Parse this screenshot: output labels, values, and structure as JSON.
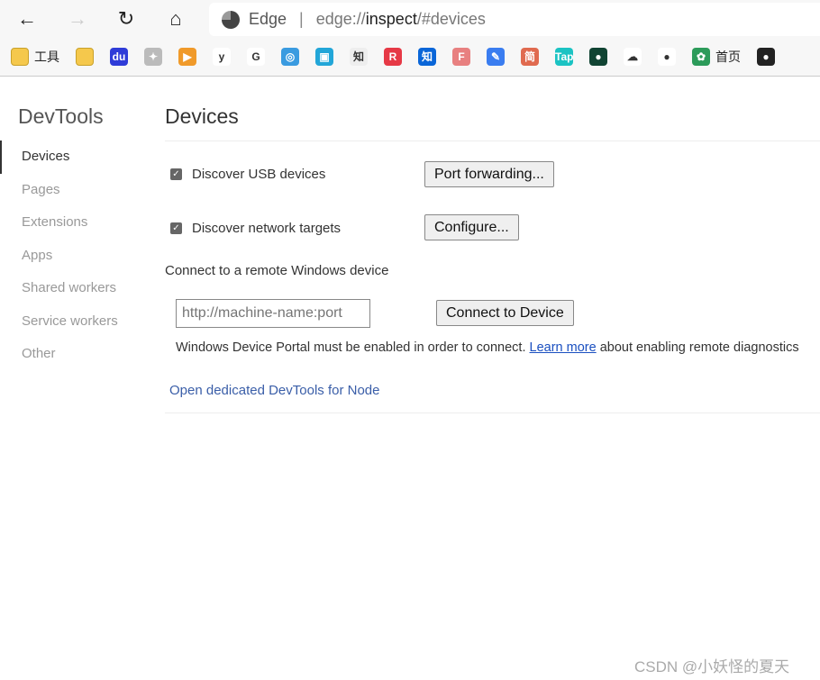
{
  "browser": {
    "address_brand": "Edge",
    "url_prefix": "edge://",
    "url_host": "inspect",
    "url_rest": "/#devices",
    "nav": {
      "back": "←",
      "forward": "→",
      "reload": "↻",
      "home": "⌂"
    }
  },
  "bookmarks": [
    {
      "icon": "folder-icon",
      "label": "工具",
      "color": "#f5c84c",
      "glyph": ""
    },
    {
      "icon": "folder-icon",
      "label": "",
      "color": "#f5c84c",
      "glyph": ""
    },
    {
      "icon": "baidu-icon",
      "label": "",
      "color": "#2f3cd8",
      "glyph": "du"
    },
    {
      "icon": "bird-icon",
      "label": "",
      "color": "#bbbbbb",
      "glyph": "✦"
    },
    {
      "icon": "video-icon",
      "label": "",
      "color": "#f09a2a",
      "glyph": "▶"
    },
    {
      "icon": "y-icon",
      "label": "",
      "color": "#ffffff",
      "glyph": "y"
    },
    {
      "icon": "google-icon",
      "label": "",
      "color": "#ffffff",
      "glyph": "G"
    },
    {
      "icon": "qqbrowser-icon",
      "label": "",
      "color": "#3a9be0",
      "glyph": "◎"
    },
    {
      "icon": "bilibili-icon",
      "label": "",
      "color": "#22a6d8",
      "glyph": "▣"
    },
    {
      "icon": "zhi-icon",
      "label": "",
      "color": "#eeeeee",
      "glyph": "知"
    },
    {
      "icon": "r-icon",
      "label": "",
      "color": "#e63946",
      "glyph": "R"
    },
    {
      "icon": "zhihu-icon",
      "label": "",
      "color": "#0a66d8",
      "glyph": "知"
    },
    {
      "icon": "fines-icon",
      "label": "",
      "color": "#e88080",
      "glyph": "F"
    },
    {
      "icon": "pen-icon",
      "label": "",
      "color": "#3a7df0",
      "glyph": "✎"
    },
    {
      "icon": "jian-icon",
      "label": "",
      "color": "#e06a4f",
      "glyph": "简"
    },
    {
      "icon": "tap-icon",
      "label": "",
      "color": "#1bc3c3",
      "glyph": "Tap"
    },
    {
      "icon": "circle-icon",
      "label": "",
      "color": "#114433",
      "glyph": "●"
    },
    {
      "icon": "cloud-icon",
      "label": "",
      "color": "#ffffff",
      "glyph": "☁"
    },
    {
      "icon": "head-icon",
      "label": "",
      "color": "#ffffff",
      "glyph": "●"
    },
    {
      "icon": "rabbit-icon",
      "label": "首页",
      "color": "#2c9b5a",
      "glyph": "✿"
    },
    {
      "icon": "github-icon",
      "label": "",
      "color": "#222222",
      "glyph": "●"
    }
  ],
  "sidebar": {
    "title": "DevTools",
    "items": [
      "Devices",
      "Pages",
      "Extensions",
      "Apps",
      "Shared workers",
      "Service workers",
      "Other"
    ]
  },
  "main": {
    "title": "Devices",
    "usb": {
      "label": "Discover USB devices",
      "checked": true,
      "button": "Port forwarding..."
    },
    "network": {
      "label": "Discover network targets",
      "checked": true,
      "button": "Configure..."
    },
    "remote_heading": "Connect to a remote Windows device",
    "input_placeholder": "http://machine-name:port",
    "connect_button": "Connect to Device",
    "note_pre": "Windows Device Portal must be enabled in order to connect. ",
    "note_link": "Learn more",
    "note_post": " about enabling remote diagnostics",
    "node_link": "Open dedicated DevTools for Node"
  },
  "watermark": "CSDN @小妖怪的夏天"
}
